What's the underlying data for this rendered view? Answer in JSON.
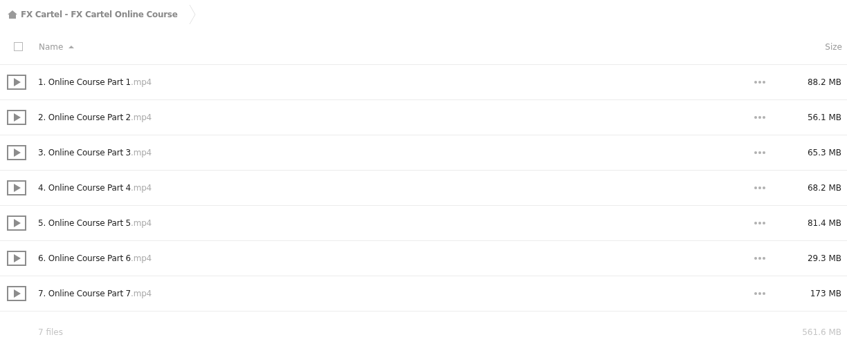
{
  "breadcrumb": {
    "label": "FX Cartel - FX Cartel Online Course"
  },
  "table": {
    "select_all": {
      "checked": false
    },
    "columns": [
      {
        "label": "Name",
        "sorted": true
      },
      {
        "label": "Size",
        "sorted": false
      }
    ],
    "rows": [
      {
        "name": "1. Online Course Part 1",
        "extension": ".mp4",
        "size": "88.2 MB"
      },
      {
        "name": "2. Online Course Part 2",
        "extension": ".mp4",
        "size": "56.1 MB"
      },
      {
        "name": "3. Online Course Part 3",
        "extension": ".mp4",
        "size": "65.3 MB"
      },
      {
        "name": "4. Online Course Part 4",
        "extension": ".mp4",
        "size": "68.2 MB"
      },
      {
        "name": "5. Online Course Part 5",
        "extension": ".mp4",
        "size": "81.4 MB"
      },
      {
        "name": "6. Online Course Part 6",
        "extension": ".mp4",
        "size": "29.3 MB"
      },
      {
        "name": "7. Online Course Part 7",
        "extension": ".mp4",
        "size": "173 MB"
      }
    ]
  },
  "footer": {
    "count": "7 files",
    "total": "561.6 MB"
  }
}
